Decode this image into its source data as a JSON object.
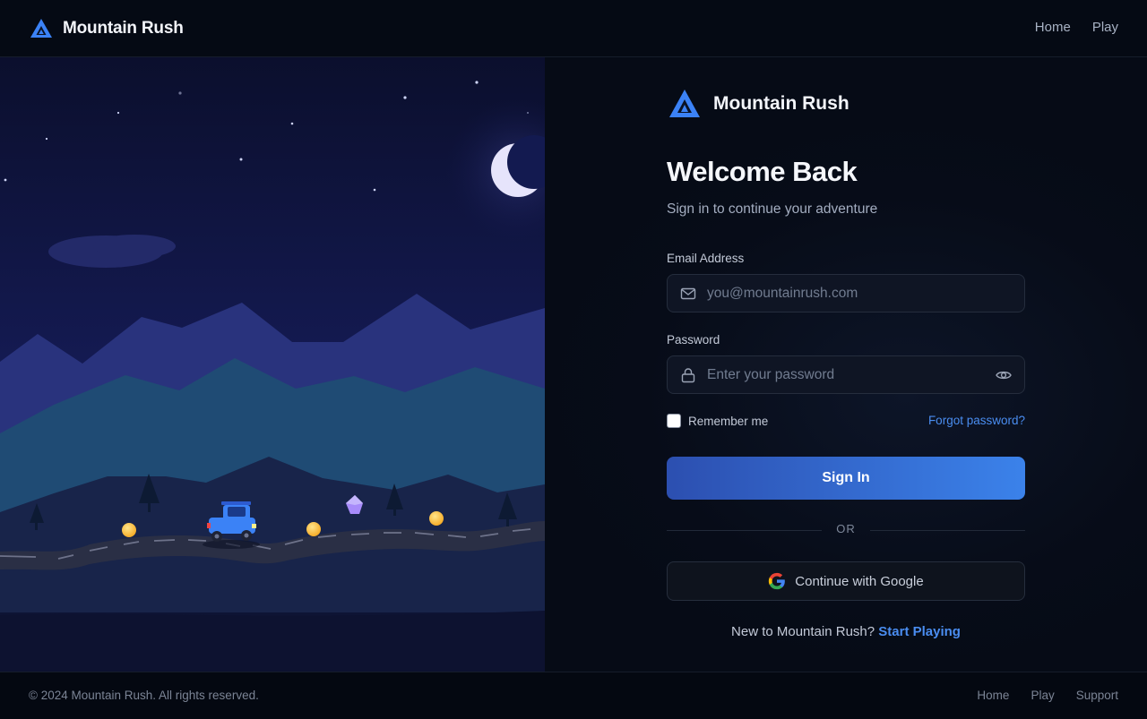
{
  "header": {
    "brand_name": "Mountain Rush",
    "nav": [
      {
        "label": "Home"
      },
      {
        "label": "Play"
      }
    ]
  },
  "form": {
    "brand_name": "Mountain Rush",
    "title": "Welcome Back",
    "subtitle": "Sign in to continue your adventure",
    "email": {
      "label": "Email Address",
      "placeholder": "you@mountainrush.com",
      "value": ""
    },
    "password": {
      "label": "Password",
      "placeholder": "Enter your password",
      "value": ""
    },
    "remember_label": "Remember me",
    "remember_checked": false,
    "forgot_label": "Forgot password?",
    "submit_label": "Sign In",
    "divider_label": "OR",
    "google_label": "Continue with Google",
    "signup_prompt": "New to Mountain Rush?",
    "signup_link": "Start Playing"
  },
  "footer": {
    "copyright": "© 2024 Mountain Rush. All rights reserved.",
    "links": [
      {
        "label": "Home"
      },
      {
        "label": "Play"
      },
      {
        "label": "Support"
      }
    ]
  },
  "icons": {
    "brand": "mountain-logo-icon",
    "email": "mail-icon",
    "password": "lock-icon",
    "toggle": "eye-icon",
    "google": "google-icon"
  },
  "colors": {
    "accent": "#3b82f6",
    "link": "#4a8df0",
    "background": "#060b16"
  }
}
